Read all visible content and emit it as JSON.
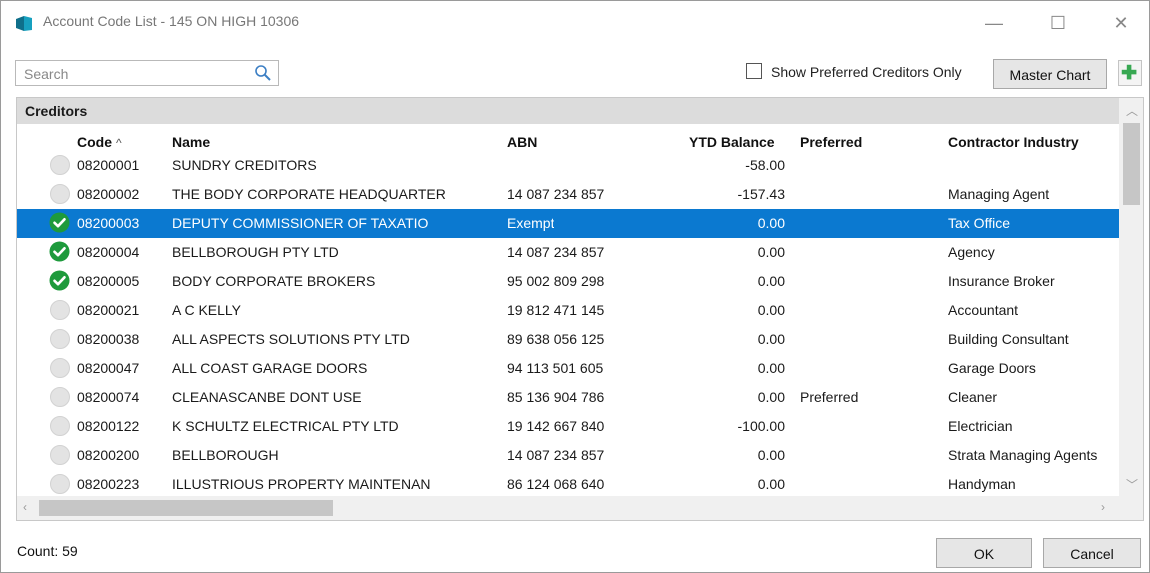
{
  "window": {
    "title": "Account Code List - 145 ON HIGH 10306",
    "minimize_glyph": "—",
    "maximize_glyph": "☐",
    "close_glyph": "✕"
  },
  "toolbar": {
    "search_placeholder": "Search",
    "search_value": "",
    "preferred_only_label": "Show Preferred Creditors Only",
    "preferred_only_checked": false,
    "master_chart_label": "Master Chart",
    "add_icon": "plus-icon"
  },
  "grid": {
    "group_label": "Creditors",
    "columns": {
      "code": "Code",
      "name": "Name",
      "abn": "ABN",
      "ytd": "YTD Balance",
      "preferred": "Preferred",
      "industry": "Contractor Industry"
    },
    "sort_indicator": "^",
    "rows": [
      {
        "checked": false,
        "code": "08200001",
        "name": "SUNDRY CREDITORS",
        "abn": "",
        "ytd": "-58.00",
        "preferred": "",
        "industry": ""
      },
      {
        "checked": false,
        "code": "08200002",
        "name": "THE BODY CORPORATE HEADQUARTER",
        "abn": "14 087 234 857",
        "ytd": "-157.43",
        "preferred": "",
        "industry": "Managing Agent"
      },
      {
        "checked": true,
        "code": "08200003",
        "name": "DEPUTY COMMISSIONER OF TAXATIO",
        "abn": "Exempt",
        "ytd": "0.00",
        "preferred": "",
        "industry": "Tax Office"
      },
      {
        "checked": true,
        "code": "08200004",
        "name": "BELLBOROUGH PTY LTD",
        "abn": "14 087 234 857",
        "ytd": "0.00",
        "preferred": "",
        "industry": "Agency"
      },
      {
        "checked": true,
        "code": "08200005",
        "name": "BODY CORPORATE BROKERS",
        "abn": "95 002 809 298",
        "ytd": "0.00",
        "preferred": "",
        "industry": "Insurance Broker"
      },
      {
        "checked": false,
        "code": "08200021",
        "name": "A C KELLY",
        "abn": "19 812 471 145",
        "ytd": "0.00",
        "preferred": "",
        "industry": "Accountant"
      },
      {
        "checked": false,
        "code": "08200038",
        "name": "ALL ASPECTS SOLUTIONS PTY LTD",
        "abn": "89 638 056 125",
        "ytd": "0.00",
        "preferred": "",
        "industry": "Building Consultant"
      },
      {
        "checked": false,
        "code": "08200047",
        "name": "ALL COAST GARAGE DOORS",
        "abn": "94 113 501 605",
        "ytd": "0.00",
        "preferred": "",
        "industry": "Garage Doors"
      },
      {
        "checked": false,
        "code": "08200074",
        "name": "CLEANASCANBE DONT USE",
        "abn": "85 136 904 786",
        "ytd": "0.00",
        "preferred": "Preferred",
        "industry": "Cleaner"
      },
      {
        "checked": false,
        "code": "08200122",
        "name": "K SCHULTZ ELECTRICAL PTY LTD",
        "abn": "19 142 667 840",
        "ytd": "-100.00",
        "preferred": "",
        "industry": "Electrician"
      },
      {
        "checked": false,
        "code": "08200200",
        "name": "BELLBOROUGH",
        "abn": "14 087 234 857",
        "ytd": "0.00",
        "preferred": "",
        "industry": "Strata Managing Agents"
      },
      {
        "checked": false,
        "code": "08200223",
        "name": "ILLUSTRIOUS PROPERTY MAINTENAN",
        "abn": "86 124 068 640",
        "ytd": "0.00",
        "preferred": "",
        "industry": "Handyman"
      }
    ]
  },
  "footer": {
    "count_label": "Count: 59",
    "ok_label": "OK",
    "cancel_label": "Cancel"
  },
  "colors": {
    "selection": "#0b79d0",
    "check_green": "#1e9a3c",
    "add_green": "#37a852"
  }
}
